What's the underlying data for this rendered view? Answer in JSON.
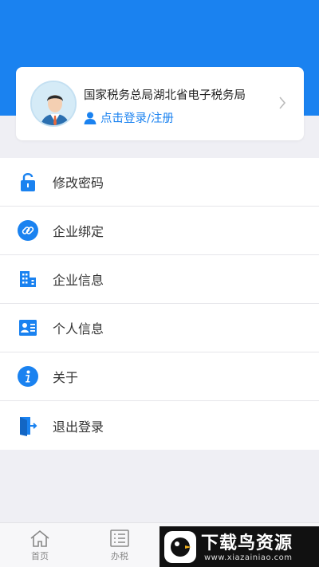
{
  "profile": {
    "title": "国家税务总局湖北省电子税务局",
    "login_label": "点击登录/注册"
  },
  "menu": {
    "items": [
      {
        "label": "修改密码",
        "icon": "lock-icon"
      },
      {
        "label": "企业绑定",
        "icon": "link-icon"
      },
      {
        "label": "企业信息",
        "icon": "building-icon"
      },
      {
        "label": "个人信息",
        "icon": "id-card-icon"
      },
      {
        "label": "关于",
        "icon": "info-icon"
      },
      {
        "label": "退出登录",
        "icon": "logout-icon"
      }
    ]
  },
  "tabbar": {
    "tabs": [
      {
        "label": "首页",
        "icon": "home-icon"
      },
      {
        "label": "办税",
        "icon": "list-icon"
      }
    ]
  },
  "watermark": {
    "title": "下载鸟资源",
    "url": "www.xiazainiao.com"
  },
  "colors": {
    "accent": "#1a82f0",
    "background": "#efeff4"
  }
}
